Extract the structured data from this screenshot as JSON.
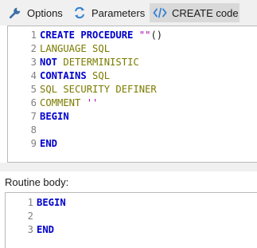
{
  "tabs": {
    "options_label": "Options",
    "parameters_label": "Parameters",
    "create_code_label": "CREATE code"
  },
  "colors": {
    "keyword": "#0000cc",
    "option": "#7b7b00",
    "string": "#b000b0",
    "line_number": "#808080",
    "active_tab": "#d9d9d9"
  },
  "create_code": {
    "lines": [
      {
        "num": "1",
        "parts": [
          {
            "t": "CREATE PROCEDURE ",
            "c": "kw"
          },
          {
            "t": "\"\"",
            "c": "str"
          },
          {
            "t": "()",
            "c": "fn"
          }
        ]
      },
      {
        "num": "2",
        "parts": [
          {
            "t": "LANGUAGE SQL",
            "c": "olv"
          }
        ]
      },
      {
        "num": "3",
        "parts": [
          {
            "t": "NOT ",
            "c": "kw"
          },
          {
            "t": "DETERMINISTIC",
            "c": "olv"
          }
        ]
      },
      {
        "num": "4",
        "parts": [
          {
            "t": "CONTAINS ",
            "c": "kw"
          },
          {
            "t": "SQL",
            "c": "olv"
          }
        ]
      },
      {
        "num": "5",
        "parts": [
          {
            "t": "SQL SECURITY DEFINER",
            "c": "olv"
          }
        ]
      },
      {
        "num": "6",
        "parts": [
          {
            "t": "COMMENT ",
            "c": "olv"
          },
          {
            "t": "''",
            "c": "str"
          }
        ]
      },
      {
        "num": "7",
        "parts": [
          {
            "t": "BEGIN",
            "c": "kw"
          }
        ]
      },
      {
        "num": "8",
        "parts": []
      },
      {
        "num": "9",
        "parts": [
          {
            "t": "END",
            "c": "kw"
          }
        ]
      }
    ]
  },
  "routine_body": {
    "label": "Routine body:",
    "lines": [
      {
        "num": "1",
        "parts": [
          {
            "t": "BEGIN",
            "c": "kw"
          }
        ]
      },
      {
        "num": "2",
        "parts": []
      },
      {
        "num": "3",
        "parts": [
          {
            "t": "END",
            "c": "kw"
          }
        ]
      }
    ]
  }
}
